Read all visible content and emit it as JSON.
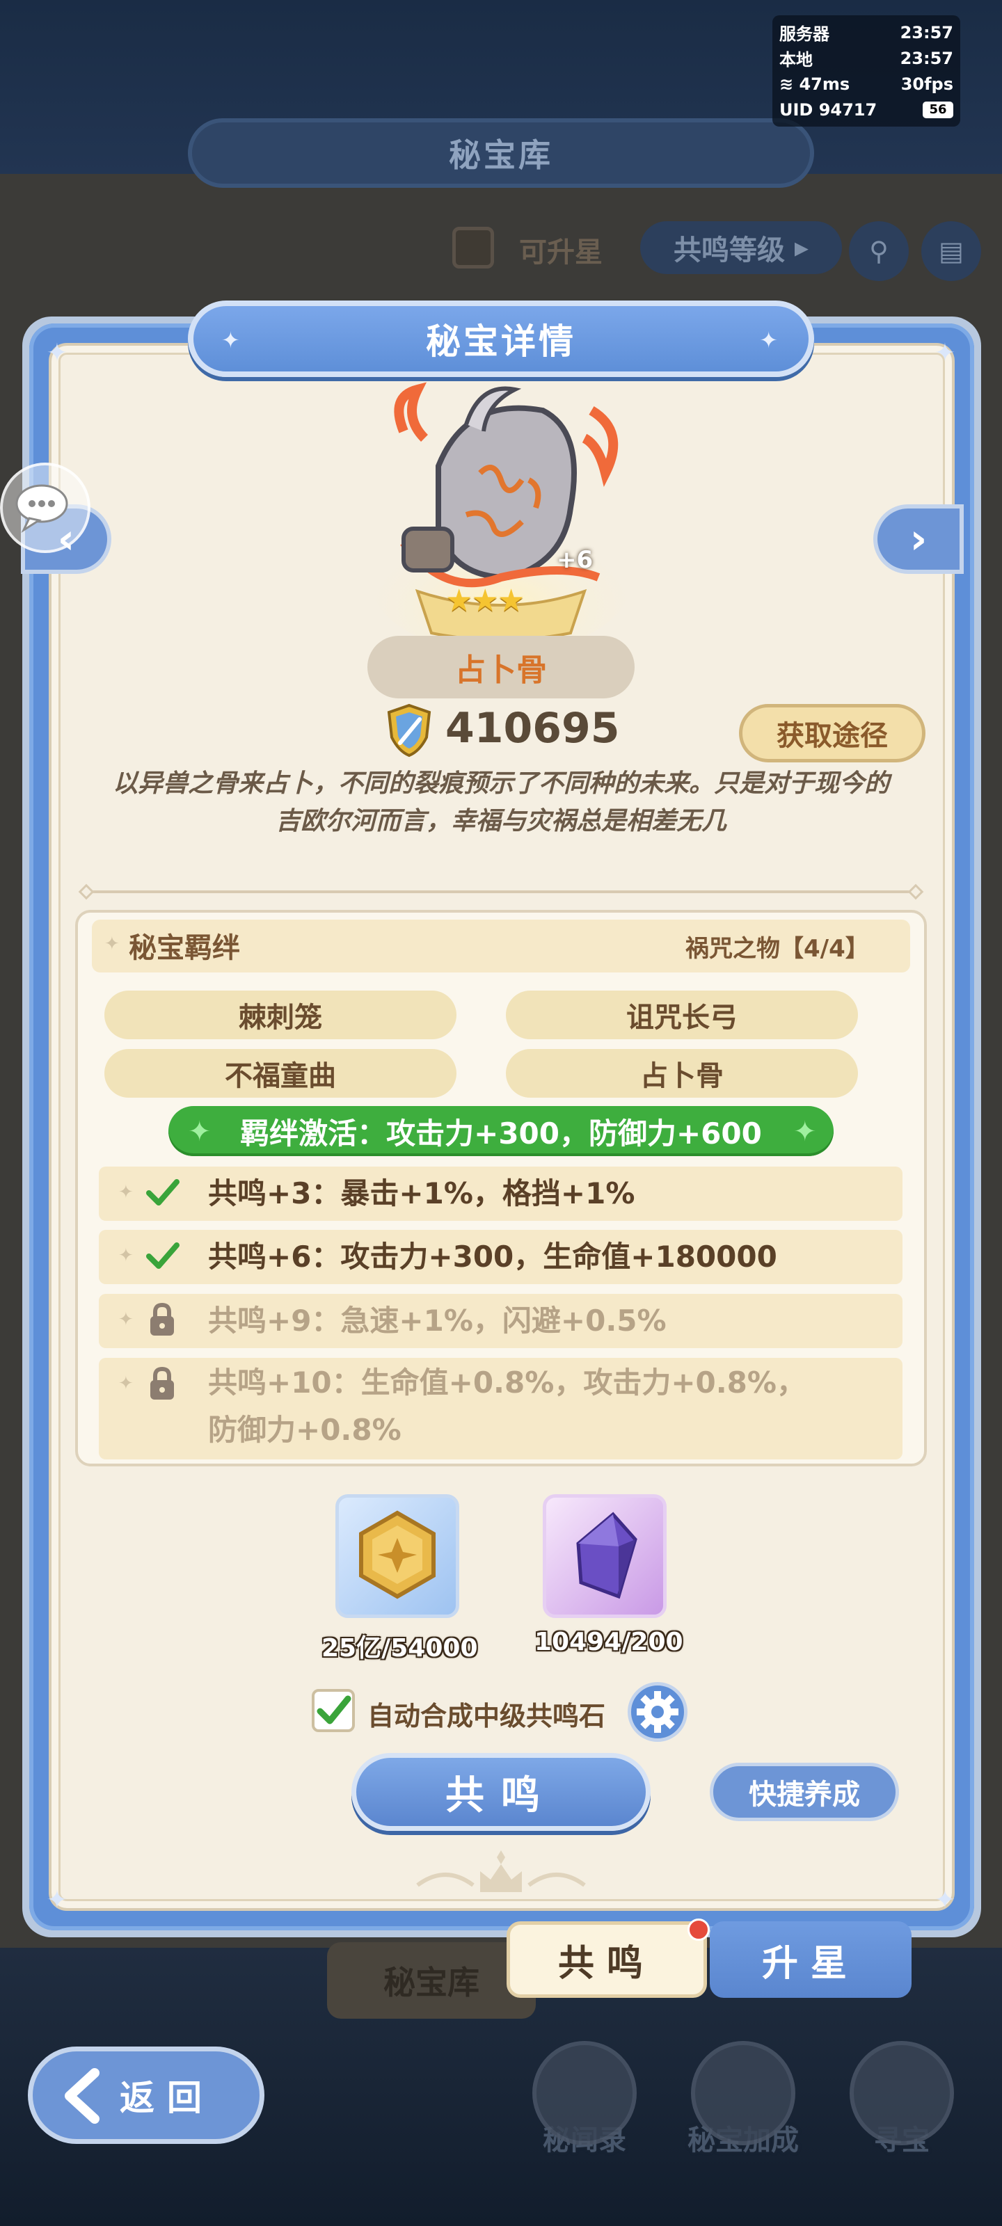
{
  "status": {
    "server_label": "服务器",
    "server_time": "23:57",
    "local_label": "本地",
    "local_time": "23:57",
    "ping": "47ms",
    "fps": "30fps",
    "uid": "UID 94717",
    "battery": "56"
  },
  "background": {
    "title": "秘宝库",
    "filter_label": "可升星",
    "sort_label": "共鸣等级",
    "tab_treasury": "秘宝库"
  },
  "modal": {
    "title": "秘宝详情",
    "artifact": {
      "name": "占卜骨",
      "plus_level": "+6",
      "stars": "★★★",
      "power": "410695",
      "obtain_label": "获取途径",
      "description": "以异兽之骨来占卜，不同的裂痕预示了不同种的未来。只是对于现今的吉欧尔河而言，幸福与灾祸总是相差无几"
    },
    "bond": {
      "title": "秘宝羁绊",
      "set_name": "祸咒之物【4/4】",
      "members": [
        "棘刺笼",
        "诅咒长弓",
        "不福童曲",
        "占卜骨"
      ],
      "active_text": "羁绊激活：攻击力+300，防御力+600",
      "effects": [
        {
          "text": "共鸣+3：暴击+1%，格挡+1%",
          "unlocked": true
        },
        {
          "text": "共鸣+6：攻击力+300，生命值+180000",
          "unlocked": true
        },
        {
          "text": "共鸣+9：急速+1%，闪避+0.5%",
          "unlocked": false
        },
        {
          "text": "共鸣+10：生命值+0.8%，攻击力+0.8%，",
          "text2": "防御力+0.8%",
          "unlocked": false
        }
      ]
    },
    "materials": [
      {
        "name": "resonance-coin",
        "count": "25亿/54000"
      },
      {
        "name": "resonance-crystal",
        "count": "10494/200"
      }
    ],
    "auto_label": "自动合成中级共鸣石",
    "auto_checked": true,
    "resonate_label": "共鸣",
    "quick_label": "快捷养成"
  },
  "tabs": {
    "resonate": "共鸣",
    "upstar": "升星"
  },
  "nav": {
    "back": "返回",
    "items": [
      "秘闻录",
      "秘宝加成",
      "寻宝"
    ]
  },
  "colors": {
    "primary_blue": "#5e8fd8",
    "paper": "#f5efe2",
    "active_green": "#3eae3e",
    "name_orange": "#d8742a",
    "badge_red": "#e54a3c"
  }
}
